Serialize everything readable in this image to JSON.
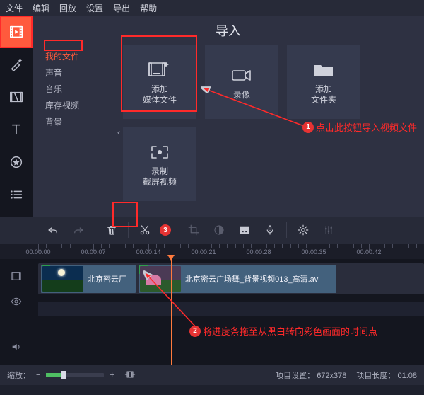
{
  "menu": {
    "file": "文件",
    "edit": "编辑",
    "playback": "回放",
    "settings": "设置",
    "export": "导出",
    "help": "帮助"
  },
  "content": {
    "title": "导入",
    "categories": [
      "我的文件",
      "声音",
      "音乐",
      "库存视频",
      "背景"
    ],
    "selected_category": "我的文件",
    "tiles": {
      "add_media": "添加\n媒体文件",
      "record_video": "录像",
      "add_folder": "添加\n文件夹",
      "screen_capture": "录制\n截屏视频"
    }
  },
  "annotations": {
    "n1": "1",
    "t1": "点击此按钮导入视频文件",
    "n2": "2",
    "t2": "将进度条拖至从黑白转向彩色画面的时间点",
    "n3": "3"
  },
  "ruler": {
    "ticks": [
      "00:00:00",
      "00:00:07",
      "00:00:14",
      "00:00:21",
      "00:00:28",
      "00:00:35",
      "00:00:42"
    ]
  },
  "clips": {
    "c1": "北京密云厂",
    "c2": "北京密云广场舞_背景视频013_高清.avi"
  },
  "status": {
    "zoom_label": "缩放：",
    "project_settings_label": "项目设置：",
    "project_settings_value": "672x378",
    "project_length_label": "项目长度：",
    "project_length_value": "01:08"
  }
}
